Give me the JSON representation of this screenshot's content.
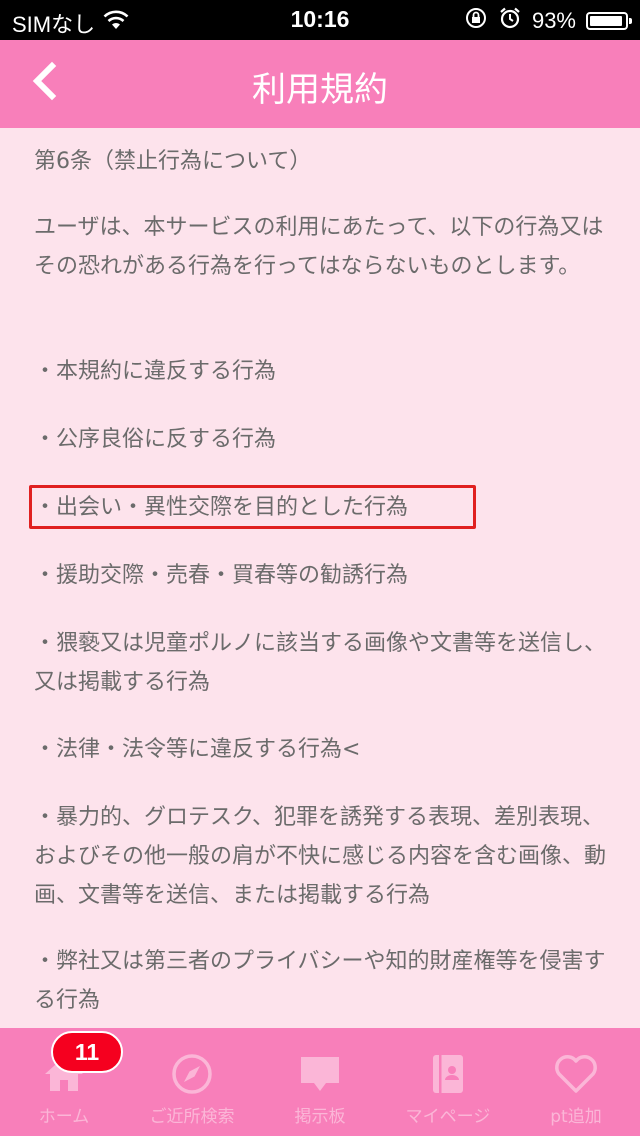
{
  "status_bar": {
    "carrier": "SIMなし",
    "time": "10:16",
    "battery_percent": "93%",
    "battery_level": 0.93,
    "icons": [
      "wifi-icon",
      "orientation-lock-icon",
      "alarm-icon",
      "battery-icon"
    ]
  },
  "nav": {
    "title": "利用規約",
    "back_icon": "chevron-left-icon"
  },
  "content": {
    "paragraphs": [
      "第6条（禁止行為について）",
      "ユーザは、本サービスの利用にあたって、以下の行為又はその恐れがある行為を行ってはならないものとします。",
      "・本規約に違反する行為",
      "・公序良俗に反する行為",
      "・出会い・異性交際を目的とした行為",
      "・援助交際・売春・買春等の勧誘行為",
      "・猥褻又は児童ポルノに該当する画像や文書等を送信し、又は掲載する行為",
      "・法律・法令等に違反する行為<",
      "・暴力的、グロテスク、犯罪を誘発する表現、差別表現、およびその他一般の肩が不快に感じる内容を含む画像、動画、文書等を送信、または掲載する行為",
      "・弊社又は第三者のプライバシーや知的財産権等を侵害する行為"
    ]
  },
  "tab_bar": {
    "badge": "11",
    "items": [
      {
        "label": "ホーム",
        "icon": "home-icon"
      },
      {
        "label": "ご近所検索",
        "icon": "compass-icon"
      },
      {
        "label": "掲示板",
        "icon": "chat-bubble-icon"
      },
      {
        "label": "マイページ",
        "icon": "notebook-icon"
      },
      {
        "label": "pt追加",
        "icon": "heart-icon"
      }
    ]
  },
  "colors": {
    "header": "#f87fba",
    "background": "#fde3ec",
    "text": "#6b6b6b",
    "highlight": "#e02020",
    "badge": "#f5001f",
    "tab_inactive": "#fbb6d7"
  }
}
